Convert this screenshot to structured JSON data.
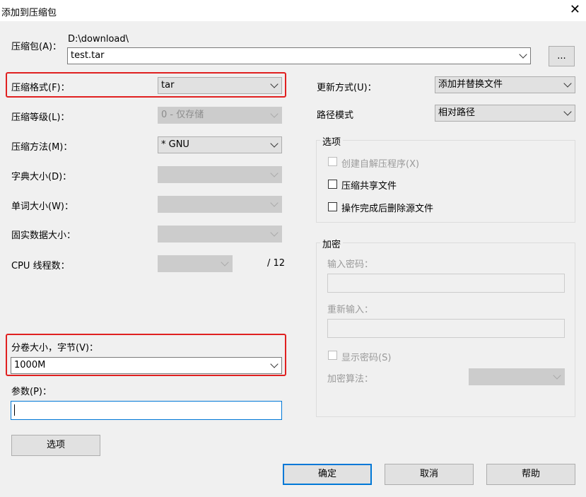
{
  "window": {
    "title": "添加到压缩包",
    "close_glyph": "✕"
  },
  "archive": {
    "label": "压缩包(A)：",
    "path": "D:\\download\\",
    "filename": "test.tar",
    "browse_label": "..."
  },
  "left": {
    "format": {
      "label": "压缩格式(F)：",
      "value": "tar"
    },
    "level": {
      "label": "压缩等级(L)：",
      "value": "0 - 仅存储"
    },
    "method": {
      "label": "压缩方法(M)：",
      "value": "* GNU"
    },
    "dict": {
      "label": "字典大小(D)：",
      "value": ""
    },
    "word": {
      "label": "单词大小(W)：",
      "value": ""
    },
    "solid": {
      "label": "固实数据大小：",
      "value": ""
    },
    "threads": {
      "label": "CPU 线程数：",
      "value": "",
      "total": "/ 12"
    },
    "volume": {
      "label": "分卷大小，字节(V)：",
      "value": "1000M"
    },
    "params": {
      "label": "参数(P)：",
      "value": ""
    },
    "options_button": "选项"
  },
  "right": {
    "update": {
      "label": "更新方式(U)：",
      "value": "添加并替换文件"
    },
    "pathmode": {
      "label": "路径模式",
      "value": "相对路径"
    },
    "options": {
      "title": "选项",
      "sfx": "创建自解压程序(X)",
      "shared": "压缩共享文件",
      "delete": "操作完成后删除源文件"
    },
    "encryption": {
      "title": "加密",
      "password_label": "输入密码：",
      "reenter_label": "重新输入：",
      "show_password": "显示密码(S)",
      "method_label": "加密算法："
    }
  },
  "buttons": {
    "ok": "确定",
    "cancel": "取消",
    "help": "帮助"
  },
  "colors": {
    "highlight": "#e02020",
    "focus": "#0078d7",
    "background": "#f0f0f0"
  }
}
